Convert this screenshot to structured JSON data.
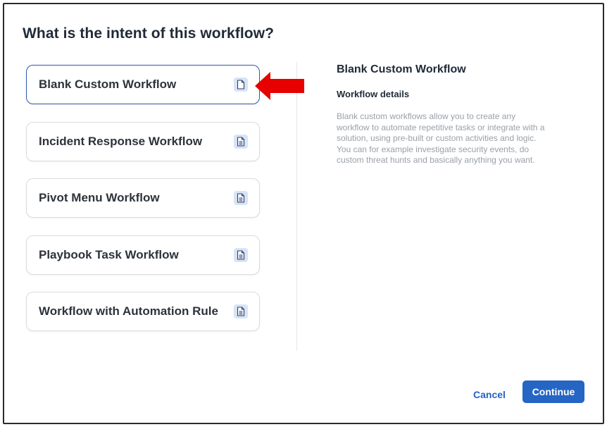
{
  "dialog": {
    "title": "What is the intent of this workflow?"
  },
  "options": [
    {
      "label": "Blank Custom Workflow",
      "selected": true,
      "icon": "document-icon"
    },
    {
      "label": "Incident Response Workflow",
      "selected": false,
      "icon": "document-lines-icon"
    },
    {
      "label": "Pivot Menu Workflow",
      "selected": false,
      "icon": "document-lines-icon"
    },
    {
      "label": "Playbook Task Workflow",
      "selected": false,
      "icon": "document-lines-icon"
    },
    {
      "label": "Workflow with Automation Rule",
      "selected": false,
      "icon": "document-lines-icon"
    }
  ],
  "details": {
    "title": "Blank Custom Workflow",
    "subtitle": "Workflow details",
    "description": "Blank custom workflows allow you to create any workflow to automate repetitive tasks or integrate with a solution, using pre-built or custom activities and logic. You can for example investigate security events, do custom threat hunts and basically anything you want."
  },
  "footer": {
    "cancel_label": "Cancel",
    "continue_label": "Continue"
  },
  "colors": {
    "accent": "#2565c4",
    "selected_border": "#2e5aa8",
    "annotation_arrow": "#e60000"
  }
}
